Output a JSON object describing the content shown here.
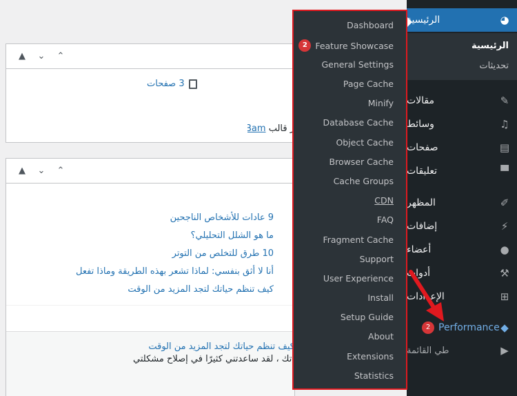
{
  "sidebar": {
    "dashboard": "الرئيسية",
    "sub_home": "الرئيسية",
    "sub_updates": "تحديثات",
    "items": [
      {
        "label": "مقالات",
        "icon": "pin-icon"
      },
      {
        "label": "وسائط",
        "icon": "media-icon"
      },
      {
        "label": "صفحات",
        "icon": "pages-icon"
      },
      {
        "label": "تعليقات",
        "icon": "comments-icon"
      },
      {
        "label": "المظهر",
        "icon": "brush-icon"
      },
      {
        "label": "إضافات",
        "icon": "plugins-icon"
      },
      {
        "label": "أعضاء",
        "icon": "users-icon"
      },
      {
        "label": "أدوات",
        "icon": "tools-icon"
      },
      {
        "label": "الإعدادات",
        "icon": "settings-icon"
      }
    ],
    "performance": {
      "label": "Performance",
      "badge": "2"
    },
    "collapse": "طي القائمة"
  },
  "flyout": {
    "items": [
      {
        "label": "Dashboard"
      },
      {
        "label": "Feature Showcase",
        "badge": "2"
      },
      {
        "label": "General Settings"
      },
      {
        "label": "Page Cache"
      },
      {
        "label": "Minify"
      },
      {
        "label": "Database Cache"
      },
      {
        "label": "Object Cache"
      },
      {
        "label": "Browser Cache"
      },
      {
        "label": "Cache Groups"
      },
      {
        "label": "CDN"
      },
      {
        "label": "FAQ"
      },
      {
        "label": "Fragment Cache"
      },
      {
        "label": "Support"
      },
      {
        "label": "User Experience"
      },
      {
        "label": "Install"
      },
      {
        "label": "Setup Guide"
      },
      {
        "label": "About"
      },
      {
        "label": "Extensions"
      },
      {
        "label": "Statistics"
      }
    ]
  },
  "widget1": {
    "pages": "3 صفحات",
    "theme_prefix": "ر قالب",
    "theme_link": "Bam"
  },
  "widget2": {
    "posts": [
      "9 عادات للأشخاص الناجحين",
      "ما هو الشلل التحليلي؟",
      "10 طرق للتخلص من التوتر",
      "أنا لا أثق بنفسي: لماذا تشعر بهذه الطريقة وماذا تفعل",
      "كيف تنظم حياتك لتجد المزيد من الوقت"
    ],
    "comment_link": "كيف تنظم حياتك لتجد المزيد من الوقت",
    "comment_text": "اتك ، لقد ساعدتني كثيرًا في إصلاح مشكلتي"
  },
  "colors": {
    "accent": "#2271b1",
    "sidebar": "#1d2327",
    "highlight_border": "#e0191f"
  }
}
